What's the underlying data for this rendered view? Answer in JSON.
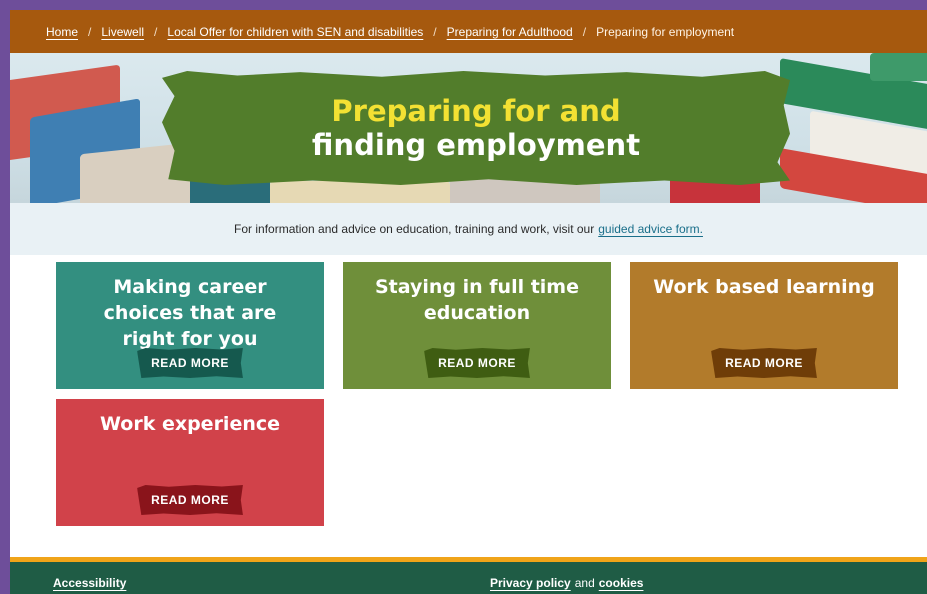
{
  "breadcrumb": {
    "items": [
      {
        "label": "Home"
      },
      {
        "label": "Livewell"
      },
      {
        "label": "Local Offer for children with SEN and disabilities"
      },
      {
        "label": "Preparing for Adulthood"
      }
    ],
    "separator": "/",
    "current": "Preparing for employment"
  },
  "hero": {
    "title_line1": "Preparing for and",
    "title_line2": "finding employment"
  },
  "info": {
    "text": "For information and advice on education, training and work, visit our",
    "link": "guided advice form."
  },
  "cards": [
    {
      "title": "Making career choices that are right for you",
      "button": "READ MORE",
      "color": "#338f80"
    },
    {
      "title": "Staying in full time education",
      "button": "READ MORE",
      "color": "#6f8f3a"
    },
    {
      "title": "Work based learning",
      "button": "READ MORE",
      "color": "#b27b2b"
    },
    {
      "title": "Work experience",
      "button": "READ MORE",
      "color": "#d1424a"
    }
  ],
  "footer": {
    "accessibility": "Accessibility",
    "privacy": "Privacy policy",
    "and": "and",
    "cookies": "cookies"
  },
  "colors": {
    "page_border": "#6e4e9a",
    "breadcrumb_bar": "#a6590e",
    "footer": "#1f5c45",
    "footer_accent": "#f0a419"
  }
}
